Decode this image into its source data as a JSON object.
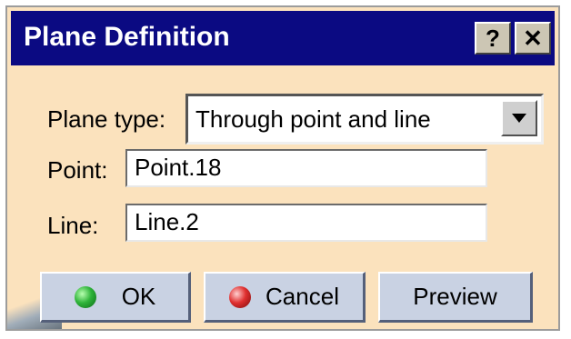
{
  "window": {
    "title": "Plane Definition",
    "help_label": "?",
    "close_label": "✕"
  },
  "form": {
    "plane_type_label": "Plane type:",
    "plane_type_value": "Through point and line",
    "point_label": "Point:",
    "point_value": "Point.18",
    "line_label": "Line:",
    "line_value": "Line.2"
  },
  "buttons": {
    "ok": "OK",
    "cancel": "Cancel",
    "preview": "Preview"
  },
  "colors": {
    "title_bar": "#0b0a82",
    "dialog_bg": "#fbe2bd",
    "button_bg": "#c9d2e3"
  },
  "icons": {
    "ok": "green-dot-icon",
    "cancel": "red-dot-icon",
    "combo": "chevron-down-icon"
  }
}
